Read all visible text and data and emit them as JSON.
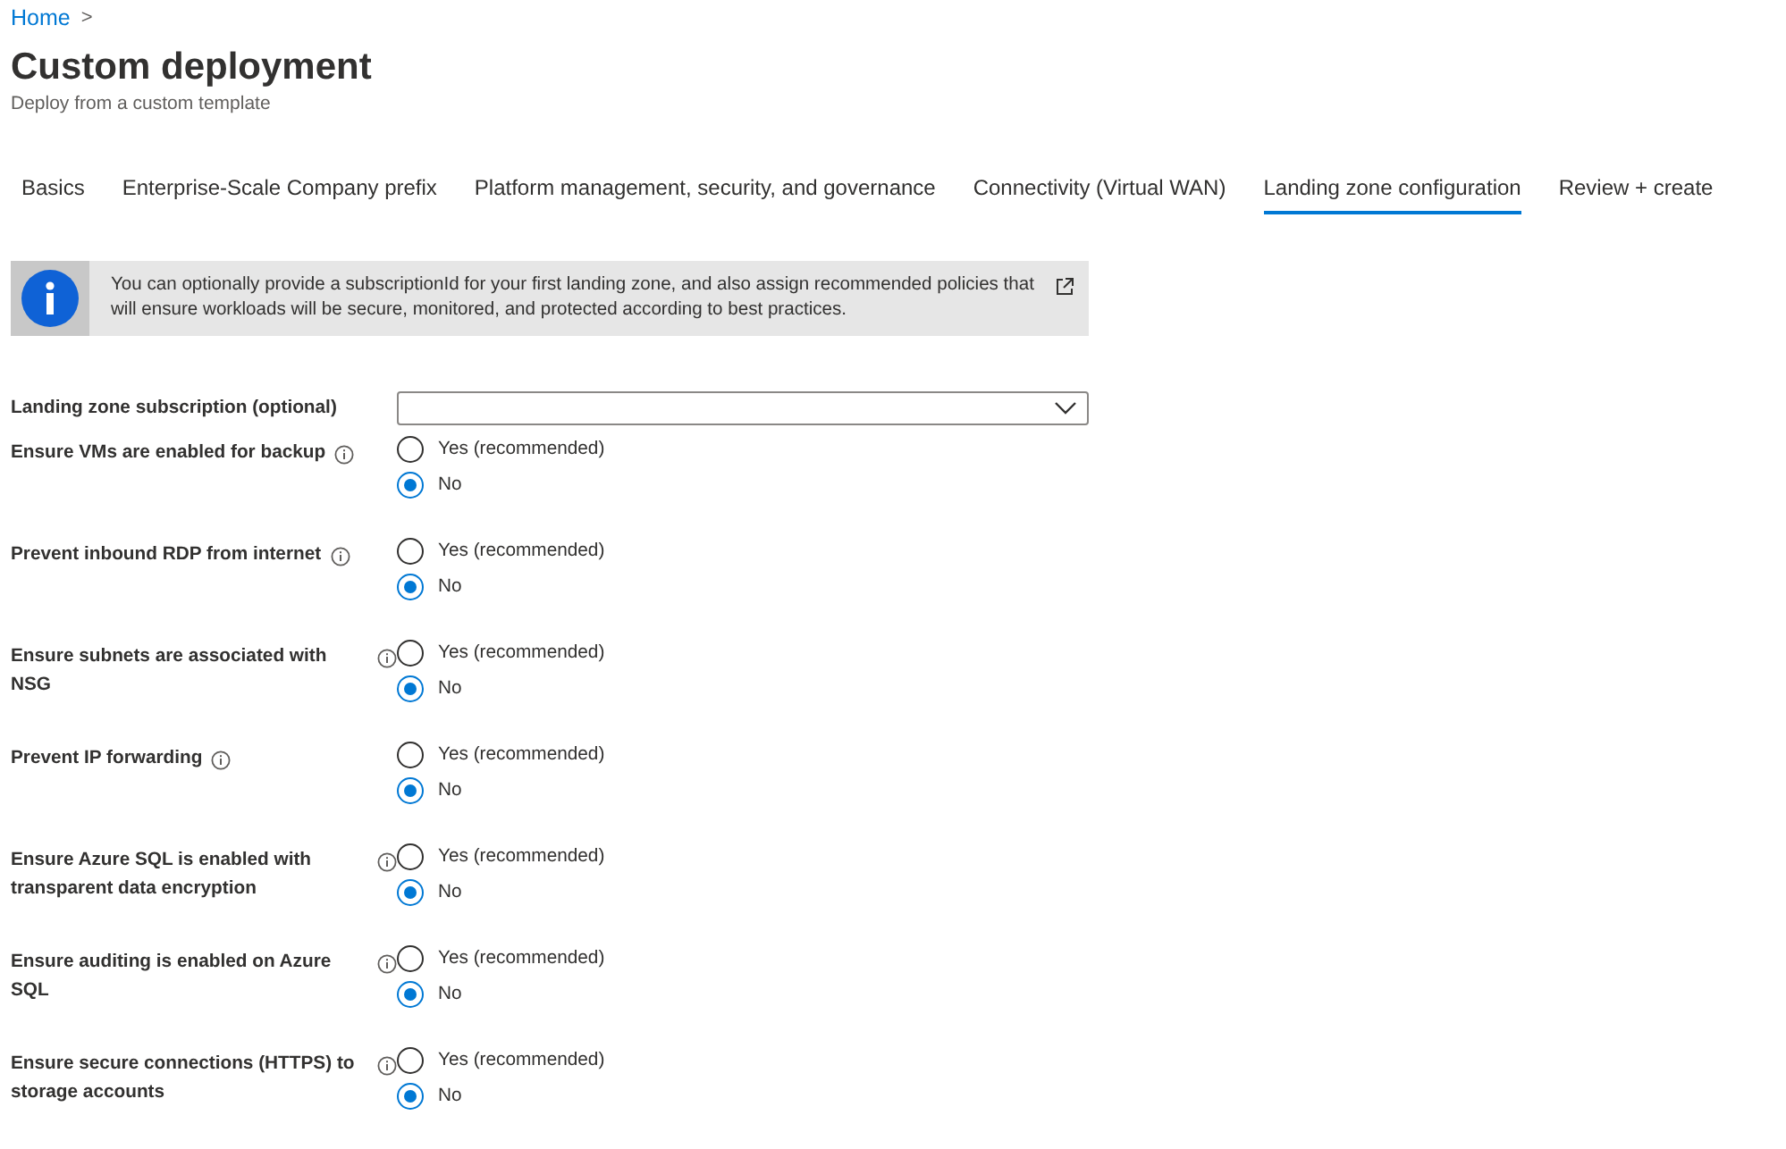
{
  "breadcrumb": {
    "link": "Home",
    "separator": ">"
  },
  "page": {
    "title": "Custom deployment",
    "subtitle": "Deploy from a custom template"
  },
  "tabs": [
    {
      "label": "Basics",
      "selected": false
    },
    {
      "label": "Enterprise-Scale Company prefix",
      "selected": false
    },
    {
      "label": "Platform management, security, and governance",
      "selected": false
    },
    {
      "label": "Connectivity (Virtual WAN)",
      "selected": false
    },
    {
      "label": "Landing zone configuration",
      "selected": true
    },
    {
      "label": "Review + create",
      "selected": false
    }
  ],
  "info_banner": {
    "text": "You can optionally provide a subscriptionId for your first landing zone, and also assign recommended policies that will ensure workloads will be secure, monitored, and protected according to best practices."
  },
  "fields": [
    {
      "kind": "dropdown",
      "label": "Landing zone subscription (optional)"
    },
    {
      "kind": "radio",
      "label": "Ensure VMs are enabled for backup",
      "options": [
        {
          "label": "Yes (recommended)",
          "selected": false
        },
        {
          "label": "No",
          "selected": true
        }
      ]
    },
    {
      "kind": "radio",
      "label": "Prevent inbound RDP from internet",
      "options": [
        {
          "label": "Yes (recommended)",
          "selected": false
        },
        {
          "label": "No",
          "selected": true
        }
      ]
    },
    {
      "kind": "radio",
      "label": "Ensure subnets are associated with NSG",
      "options": [
        {
          "label": "Yes (recommended)",
          "selected": false
        },
        {
          "label": "No",
          "selected": true
        }
      ]
    },
    {
      "kind": "radio",
      "label": "Prevent IP forwarding",
      "options": [
        {
          "label": "Yes (recommended)",
          "selected": false
        },
        {
          "label": "No",
          "selected": true
        }
      ]
    },
    {
      "kind": "radio",
      "label": "Ensure Azure SQL is enabled with transparent data encryption",
      "options": [
        {
          "label": "Yes (recommended)",
          "selected": false
        },
        {
          "label": "No",
          "selected": true
        }
      ]
    },
    {
      "kind": "radio",
      "label": "Ensure auditing is enabled on Azure SQL",
      "options": [
        {
          "label": "Yes (recommended)",
          "selected": false
        },
        {
          "label": "No",
          "selected": true
        }
      ]
    },
    {
      "kind": "radio",
      "label": "Ensure secure connections (HTTPS) to storage accounts",
      "options": [
        {
          "label": "Yes (recommended)",
          "selected": false
        },
        {
          "label": "No",
          "selected": true
        }
      ]
    }
  ]
}
